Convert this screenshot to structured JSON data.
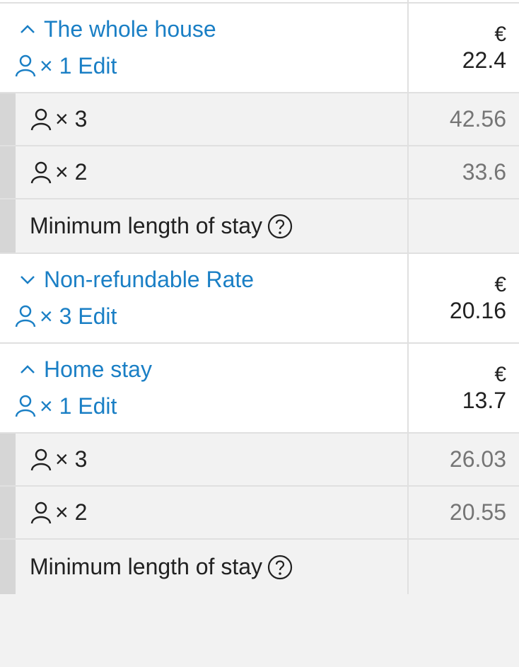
{
  "colors": {
    "link": "#1a7fc5",
    "text": "#212121",
    "muted": "#757575"
  },
  "rates": [
    {
      "title": "The whole house",
      "expanded": true,
      "occupancy": "× 1",
      "edit_label": "Edit",
      "currency": "€",
      "price": "22.4",
      "sub_rows": [
        {
          "occupancy": "× 3",
          "price": "42.56"
        },
        {
          "occupancy": "× 2",
          "price": "33.6"
        }
      ],
      "min_stay_label": "Minimum length of stay"
    },
    {
      "title": "Non-refundable Rate",
      "expanded": false,
      "occupancy": "× 3",
      "edit_label": "Edit",
      "currency": "€",
      "price": "20.16"
    },
    {
      "title": "Home stay",
      "expanded": true,
      "occupancy": "× 1",
      "edit_label": "Edit",
      "currency": "€",
      "price": "13.7",
      "sub_rows": [
        {
          "occupancy": "× 3",
          "price": "26.03"
        },
        {
          "occupancy": "× 2",
          "price": "20.55"
        }
      ],
      "min_stay_label": "Minimum length of stay"
    }
  ]
}
